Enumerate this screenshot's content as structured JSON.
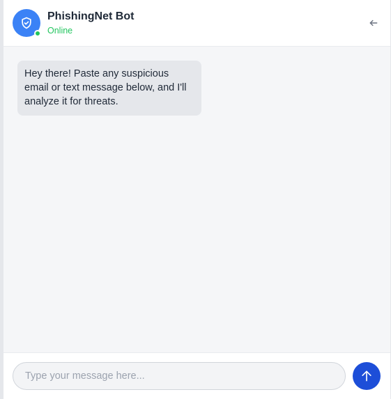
{
  "header": {
    "bot_name": "PhishingNet Bot",
    "status": "Online",
    "avatar_icon": "shield-check-icon",
    "back_icon": "arrow-left-icon"
  },
  "messages": [
    {
      "sender": "bot",
      "text": "Hey there! Paste any suspicious email or text message below, and I'll analyze it for threats."
    }
  ],
  "composer": {
    "placeholder": "Type your message here...",
    "value": "",
    "send_icon": "arrow-up-icon"
  },
  "colors": {
    "accent": "#3b82f6",
    "send_button": "#1d4ed8",
    "online": "#22c55e",
    "bubble_bg": "#e5e7eb",
    "chat_bg": "#f5f6f8"
  }
}
